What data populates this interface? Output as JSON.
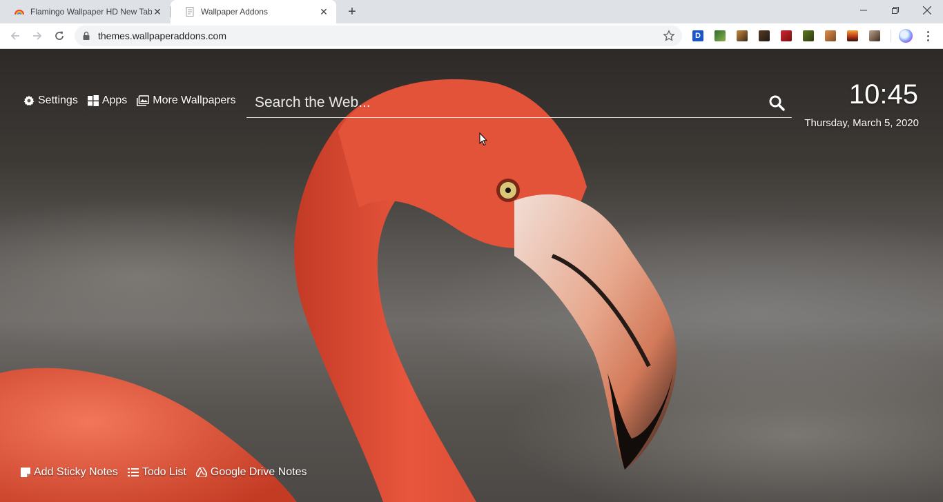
{
  "tabs": [
    {
      "title": "Flamingo Wallpaper HD New Tab",
      "active": false,
      "favicon": "flamingo-rainbow-icon"
    },
    {
      "title": "Wallpaper Addons",
      "active": true,
      "favicon": "page-icon"
    }
  ],
  "toolbar": {
    "url": "themes.wallpaperaddons.com",
    "extensions": [
      "D",
      "green",
      "tiger",
      "dark",
      "red",
      "leaf",
      "orange",
      "sunset",
      "cat"
    ]
  },
  "top_links": {
    "settings": "Settings",
    "apps": "Apps",
    "more_wallpapers": "More Wallpapers"
  },
  "search": {
    "placeholder": "Search the Web..."
  },
  "clock": {
    "time": "10:45",
    "date": "Thursday, March 5, 2020"
  },
  "bottom_links": {
    "sticky": "Add Sticky Notes",
    "todo": "Todo List",
    "drive": "Google Drive Notes"
  },
  "colors": {
    "chrome_bg": "#dee1e6",
    "toolbar_bg": "#ffffff",
    "flamingo": "#e8563d"
  }
}
